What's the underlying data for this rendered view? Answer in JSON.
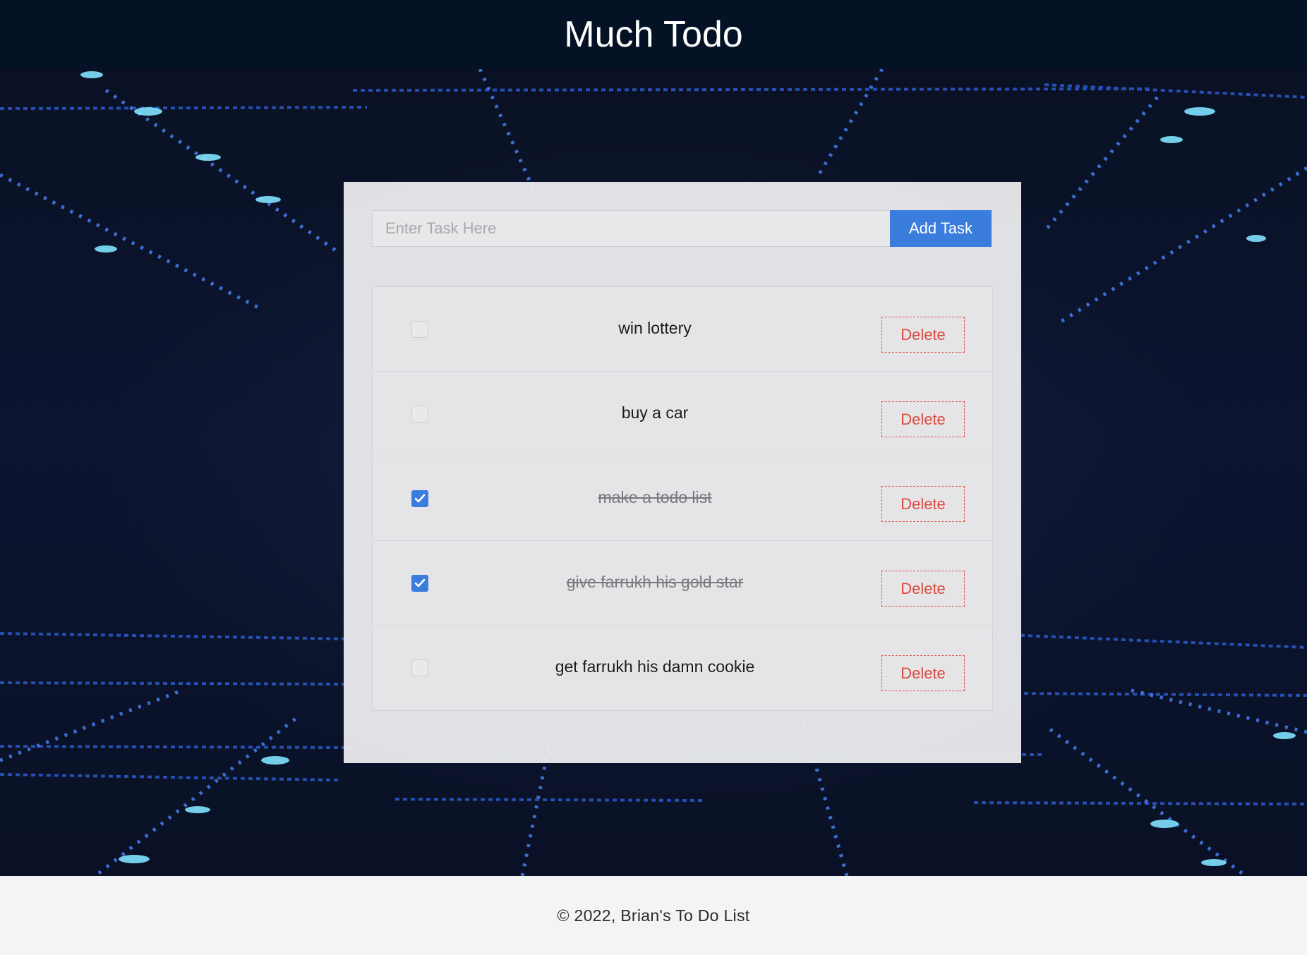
{
  "header": {
    "title": "Much Todo"
  },
  "add_task": {
    "placeholder": "Enter Task Here",
    "value": "",
    "button_label": "Add Task"
  },
  "tasks": [
    {
      "text": "win lottery",
      "completed": false,
      "delete_label": "Delete"
    },
    {
      "text": "buy a car",
      "completed": false,
      "delete_label": "Delete"
    },
    {
      "text": "make a todo list",
      "completed": true,
      "delete_label": "Delete"
    },
    {
      "text": "give farrukh his gold star",
      "completed": true,
      "delete_label": "Delete"
    },
    {
      "text": "get farrukh his damn cookie",
      "completed": false,
      "delete_label": "Delete"
    }
  ],
  "footer": {
    "text": "© 2022, Brian's To Do List"
  },
  "colors": {
    "header_bg": "#051226",
    "accent": "#3b7ddd",
    "danger": "#dc4a40",
    "footer_bg": "#f3f4f6"
  }
}
